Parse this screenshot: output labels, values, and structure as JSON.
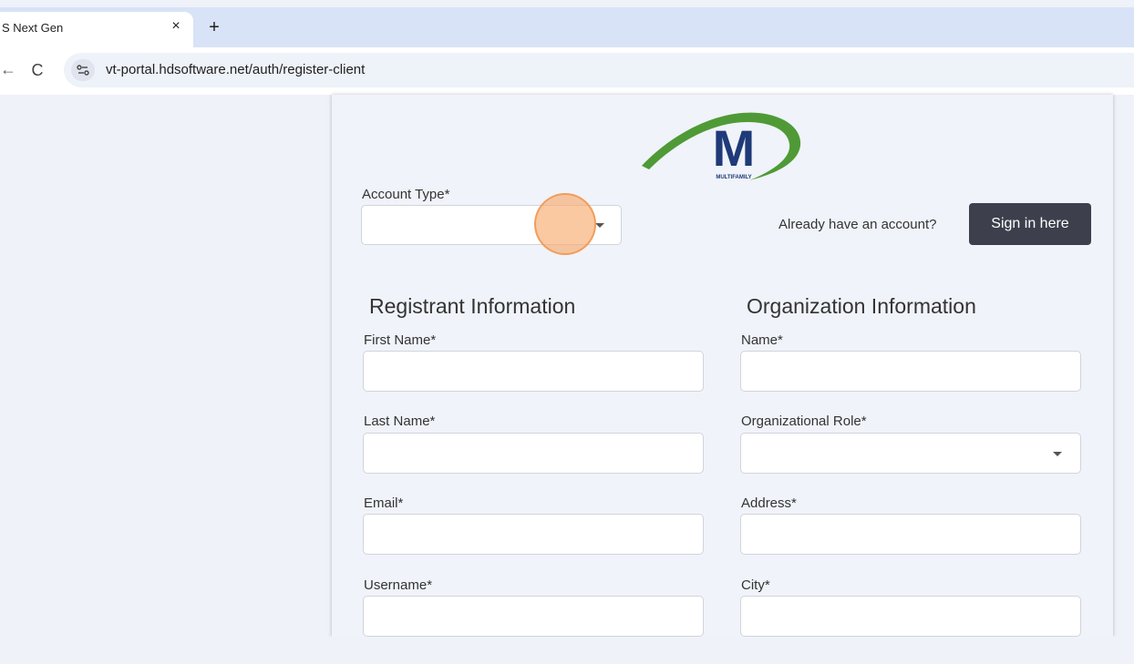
{
  "browser": {
    "tab_title": "S Next Gen",
    "tab_close": "×",
    "new_tab": "+",
    "back": "←",
    "reload": "C",
    "url": "vt-portal.hdsoftware.net/auth/register-client"
  },
  "logo": {
    "letter": "M",
    "subtitle": "MULTIFAMILY",
    "colors": {
      "navy": "#1f3a78",
      "green": "#4f9a36"
    }
  },
  "account": {
    "label": "Account Type*",
    "value": "",
    "already_text": "Already have an account?",
    "signin_label": "Sign in here"
  },
  "registrant": {
    "title": "Registrant Information",
    "fields": [
      {
        "label": "First Name*",
        "value": ""
      },
      {
        "label": "Last Name*",
        "value": ""
      },
      {
        "label": "Email*",
        "value": ""
      },
      {
        "label": "Username*",
        "value": ""
      }
    ]
  },
  "organization": {
    "title": "Organization Information",
    "fields": [
      {
        "label": "Name*",
        "value": ""
      },
      {
        "label": "Organizational Role*",
        "value": "",
        "type": "select"
      },
      {
        "label": "Address*",
        "value": ""
      },
      {
        "label": "City*",
        "value": ""
      }
    ]
  },
  "colors": {
    "button_bg": "#3d404c",
    "click_highlight": "#f7aa6e"
  }
}
